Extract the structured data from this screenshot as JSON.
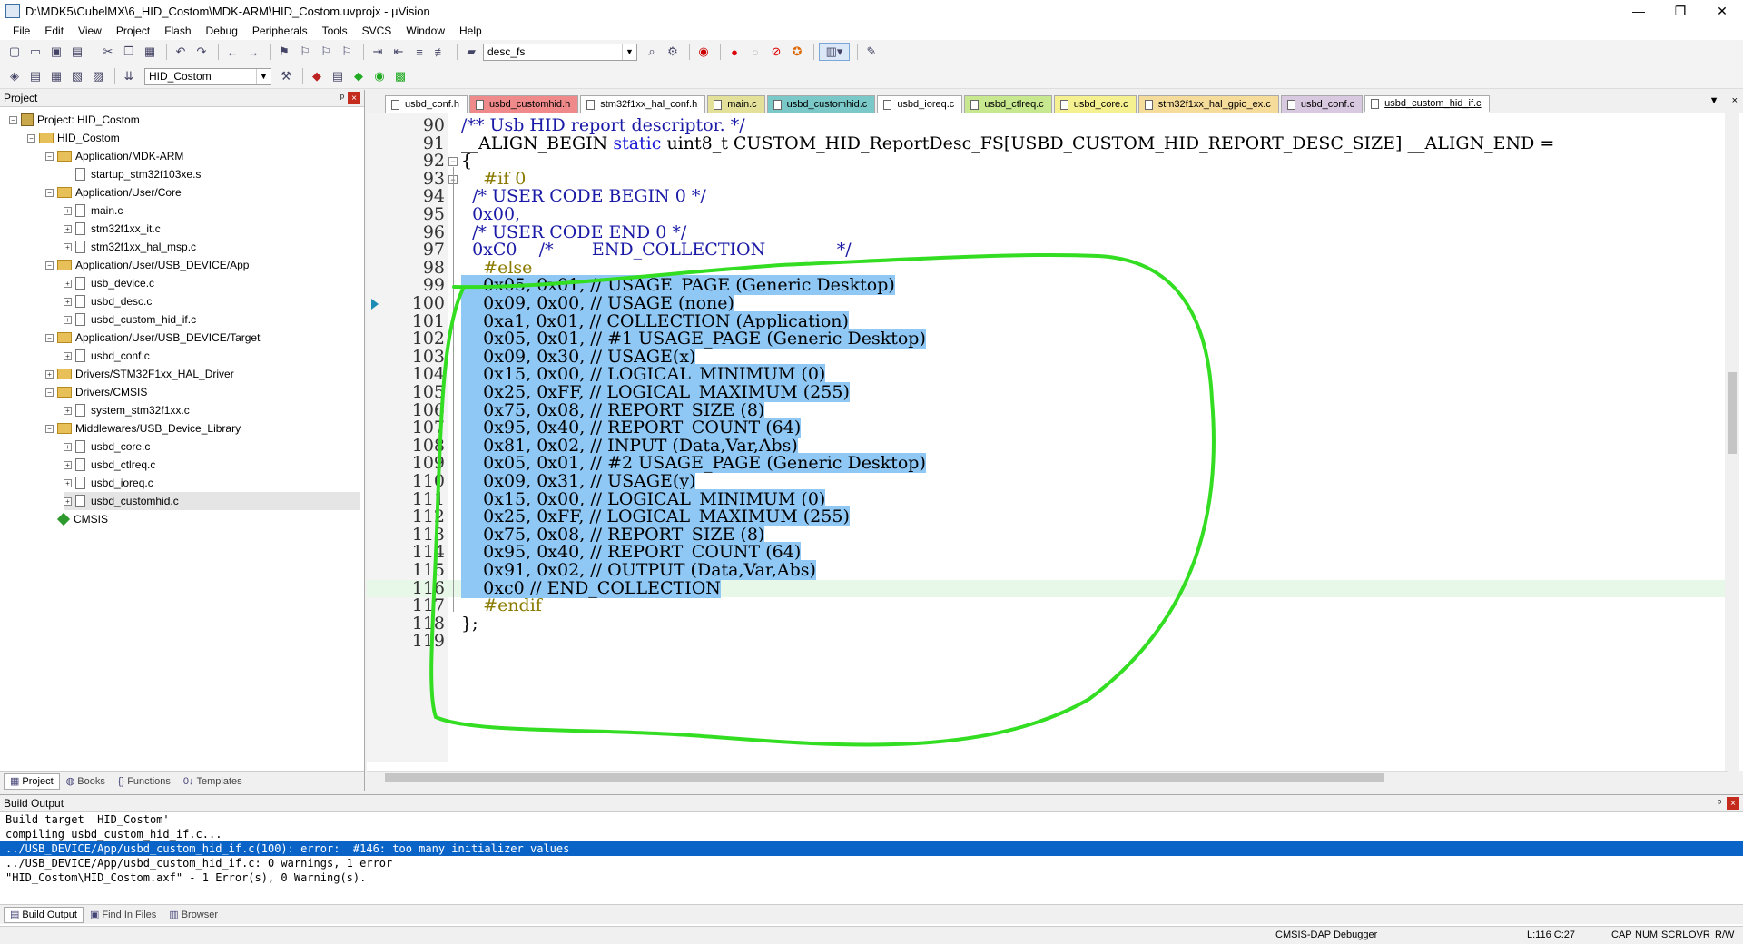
{
  "window": {
    "title": "D:\\MDK5\\CubelMX\\6_HID_Costom\\MDK-ARM\\HID_Costom.uvprojx - µVision",
    "minimize": "—",
    "maximize": "❐",
    "close": "✕"
  },
  "menu": [
    "File",
    "Edit",
    "View",
    "Project",
    "Flash",
    "Debug",
    "Peripherals",
    "Tools",
    "SVCS",
    "Window",
    "Help"
  ],
  "toolbar": {
    "find_combo": "desc_fs",
    "target_combo": "HID_Costom"
  },
  "project_panel": {
    "title": "Project",
    "pin": "ᵖ",
    "close": "×",
    "tree": [
      {
        "label": "Project: HID_Costom",
        "level": 0,
        "type": "project",
        "exp": "−"
      },
      {
        "label": "HID_Costom",
        "level": 1,
        "type": "folder",
        "exp": "−"
      },
      {
        "label": "Application/MDK-ARM",
        "level": 2,
        "type": "folder",
        "exp": "−"
      },
      {
        "label": "startup_stm32f103xe.s",
        "level": 3,
        "type": "file",
        "exp": ""
      },
      {
        "label": "Application/User/Core",
        "level": 2,
        "type": "folder",
        "exp": "−"
      },
      {
        "label": "main.c",
        "level": 3,
        "type": "file",
        "exp": "+"
      },
      {
        "label": "stm32f1xx_it.c",
        "level": 3,
        "type": "file",
        "exp": "+"
      },
      {
        "label": "stm32f1xx_hal_msp.c",
        "level": 3,
        "type": "file",
        "exp": "+"
      },
      {
        "label": "Application/User/USB_DEVICE/App",
        "level": 2,
        "type": "folder",
        "exp": "−"
      },
      {
        "label": "usb_device.c",
        "level": 3,
        "type": "file",
        "exp": "+"
      },
      {
        "label": "usbd_desc.c",
        "level": 3,
        "type": "file",
        "exp": "+"
      },
      {
        "label": "usbd_custom_hid_if.c",
        "level": 3,
        "type": "file",
        "exp": "+"
      },
      {
        "label": "Application/User/USB_DEVICE/Target",
        "level": 2,
        "type": "folder",
        "exp": "−"
      },
      {
        "label": "usbd_conf.c",
        "level": 3,
        "type": "file",
        "exp": "+"
      },
      {
        "label": "Drivers/STM32F1xx_HAL_Driver",
        "level": 2,
        "type": "folder",
        "exp": "+"
      },
      {
        "label": "Drivers/CMSIS",
        "level": 2,
        "type": "folder",
        "exp": "−"
      },
      {
        "label": "system_stm32f1xx.c",
        "level": 3,
        "type": "file",
        "exp": "+"
      },
      {
        "label": "Middlewares/USB_Device_Library",
        "level": 2,
        "type": "folder",
        "exp": "−"
      },
      {
        "label": "usbd_core.c",
        "level": 3,
        "type": "file",
        "exp": "+"
      },
      {
        "label": "usbd_ctlreq.c",
        "level": 3,
        "type": "file",
        "exp": "+"
      },
      {
        "label": "usbd_ioreq.c",
        "level": 3,
        "type": "file",
        "exp": "+"
      },
      {
        "label": "usbd_customhid.c",
        "level": 3,
        "type": "file",
        "exp": "+",
        "selected": true
      },
      {
        "label": "CMSIS",
        "level": 2,
        "type": "diamond",
        "exp": ""
      }
    ],
    "tabs": [
      "Project",
      "Books",
      "Functions",
      "Templates"
    ]
  },
  "editor_tabs": [
    {
      "label": "usbd_conf.h",
      "color": "#ffffff"
    },
    {
      "label": "usbd_customhid.h",
      "color": "#f08a8a"
    },
    {
      "label": "stm32f1xx_hal_conf.h",
      "color": "#ffffff"
    },
    {
      "label": "main.c",
      "color": "#e3e09a"
    },
    {
      "label": "usbd_customhid.c",
      "color": "#7ac8c8"
    },
    {
      "label": "usbd_ioreq.c",
      "color": "#ffffff"
    },
    {
      "label": "usbd_ctlreq.c",
      "color": "#c8e890"
    },
    {
      "label": "usbd_core.c",
      "color": "#f5f090"
    },
    {
      "label": "stm32f1xx_hal_gpio_ex.c",
      "color": "#f5dc9a"
    },
    {
      "label": "usbd_conf.c",
      "color": "#d8c8e0"
    },
    {
      "label": "usbd_custom_hid_if.c",
      "color": "#ffffff",
      "active": true
    }
  ],
  "editor_tab_controls": {
    "dropdown": "▼",
    "close": "×"
  },
  "code": [
    {
      "n": "90",
      "parts": [
        {
          "t": "/** Usb HID report descriptor. */",
          "c": "cm"
        }
      ]
    },
    {
      "n": "91",
      "parts": [
        {
          "t": "__ALIGN_BEGIN ",
          "c": "tx"
        },
        {
          "t": "static",
          "c": "kw"
        },
        {
          "t": " uint8_t CUSTOM_HID_ReportDesc_FS[USBD_CUSTOM_HID_REPORT_DESC_SIZE] __ALIGN_END =",
          "c": "tx"
        }
      ]
    },
    {
      "n": "92",
      "parts": [
        {
          "t": "{",
          "c": "tx"
        }
      ]
    },
    {
      "n": "93",
      "parts": [
        {
          "t": "    #if 0",
          "c": "pp"
        }
      ]
    },
    {
      "n": "94",
      "parts": [
        {
          "t": "  /* USER CODE BEGIN 0 */",
          "c": "cm"
        }
      ]
    },
    {
      "n": "95",
      "parts": [
        {
          "t": "  0x00,",
          "c": "cm"
        }
      ]
    },
    {
      "n": "96",
      "parts": [
        {
          "t": "  /* USER CODE END 0 */",
          "c": "cm"
        }
      ]
    },
    {
      "n": "97",
      "parts": [
        {
          "t": "  0xC0    /*       END_COLLECTION             */",
          "c": "cm"
        }
      ]
    },
    {
      "n": "98",
      "parts": [
        {
          "t": "    #else",
          "c": "pp"
        }
      ]
    },
    {
      "n": "99",
      "parts": [
        {
          "t": "    0x05, 0x01, // USAGE_PAGE (Generic Desktop)",
          "c": "tx",
          "hl": true
        }
      ]
    },
    {
      "n": "100",
      "parts": [
        {
          "t": "    0x09, 0x00, // USAGE (none)",
          "c": "tx",
          "hl": true
        }
      ]
    },
    {
      "n": "101",
      "parts": [
        {
          "t": "    0xa1, 0x01, // COLLECTION (Application)",
          "c": "tx",
          "hl": true
        }
      ]
    },
    {
      "n": "102",
      "parts": [
        {
          "t": "    0x05, 0x01, // #1 USAGE_PAGE (Generic Desktop)",
          "c": "tx",
          "hl": true
        }
      ]
    },
    {
      "n": "103",
      "parts": [
        {
          "t": "    0x09, 0x30, // USAGE(x)",
          "c": "tx",
          "hl": true
        }
      ]
    },
    {
      "n": "104",
      "parts": [
        {
          "t": "    0x15, 0x00, // LOGICAL_MINIMUM (0)",
          "c": "tx",
          "hl": true
        }
      ]
    },
    {
      "n": "105",
      "parts": [
        {
          "t": "    0x25, 0xFF, // LOGICAL_MAXIMUM (255)",
          "c": "tx",
          "hl": true
        }
      ]
    },
    {
      "n": "106",
      "parts": [
        {
          "t": "    0x75, 0x08, // REPORT_SIZE (8)",
          "c": "tx",
          "hl": true
        }
      ]
    },
    {
      "n": "107",
      "parts": [
        {
          "t": "    0x95, 0x40, // REPORT_COUNT (64)",
          "c": "tx",
          "hl": true
        }
      ]
    },
    {
      "n": "108",
      "parts": [
        {
          "t": "    0x81, 0x02, // INPUT (Data,Var,Abs)",
          "c": "tx",
          "hl": true
        }
      ]
    },
    {
      "n": "109",
      "parts": [
        {
          "t": "    0x05, 0x01, // #2 USAGE_PAGE (Generic Desktop)",
          "c": "tx",
          "hl": true
        }
      ]
    },
    {
      "n": "110",
      "parts": [
        {
          "t": "    0x09, 0x31, // USAGE(y)",
          "c": "tx",
          "hl": true
        }
      ]
    },
    {
      "n": "111",
      "parts": [
        {
          "t": "    0x15, 0x00, // LOGICAL_MINIMUM (0)",
          "c": "tx",
          "hl": true
        }
      ]
    },
    {
      "n": "112",
      "parts": [
        {
          "t": "    0x25, 0xFF, // LOGICAL_MAXIMUM (255)",
          "c": "tx",
          "hl": true
        }
      ]
    },
    {
      "n": "113",
      "parts": [
        {
          "t": "    0x75, 0x08, // REPORT_SIZE (8)",
          "c": "tx",
          "hl": true
        }
      ]
    },
    {
      "n": "114",
      "parts": [
        {
          "t": "    0x95, 0x40, // REPORT_COUNT (64)",
          "c": "tx",
          "hl": true
        }
      ]
    },
    {
      "n": "115",
      "parts": [
        {
          "t": "    0x91, 0x02, // OUTPUT (Data,Var,Abs)",
          "c": "tx",
          "hl": true
        }
      ]
    },
    {
      "n": "116",
      "parts": [
        {
          "t": "    0xc0 // END_COLLECTION",
          "c": "tx",
          "hl": true
        }
      ],
      "current": true
    },
    {
      "n": "117",
      "parts": [
        {
          "t": "    #endif",
          "c": "pp"
        }
      ]
    },
    {
      "n": "118",
      "parts": [
        {
          "t": "};",
          "c": "tx"
        }
      ]
    },
    {
      "n": "119",
      "parts": []
    }
  ],
  "build_output": {
    "title": "Build Output",
    "pin": "ᵖ",
    "close": "×",
    "lines": [
      {
        "text": "Build target 'HID_Costom'",
        "error": false
      },
      {
        "text": "compiling usbd_custom_hid_if.c...",
        "error": false
      },
      {
        "text": "../USB_DEVICE/App/usbd_custom_hid_if.c(100): error:  #146: too many initializer values",
        "error": true
      },
      {
        "text": "../USB_DEVICE/App/usbd_custom_hid_if.c: 0 warnings, 1 error",
        "error": false
      },
      {
        "text": "\"HID_Costom\\HID_Costom.axf\" - 1 Error(s), 0 Warning(s).",
        "error": false
      }
    ],
    "tabs": [
      "Build Output",
      "Find In Files",
      "Browser"
    ]
  },
  "status": {
    "debugger": "CMSIS-DAP Debugger",
    "position": "L:116 C:27",
    "caps": "CAP",
    "num": "NUM",
    "scrl": "SCRL",
    "ovr": "OVR",
    "rw": "R/W"
  },
  "annotation_color": "#33dd22"
}
